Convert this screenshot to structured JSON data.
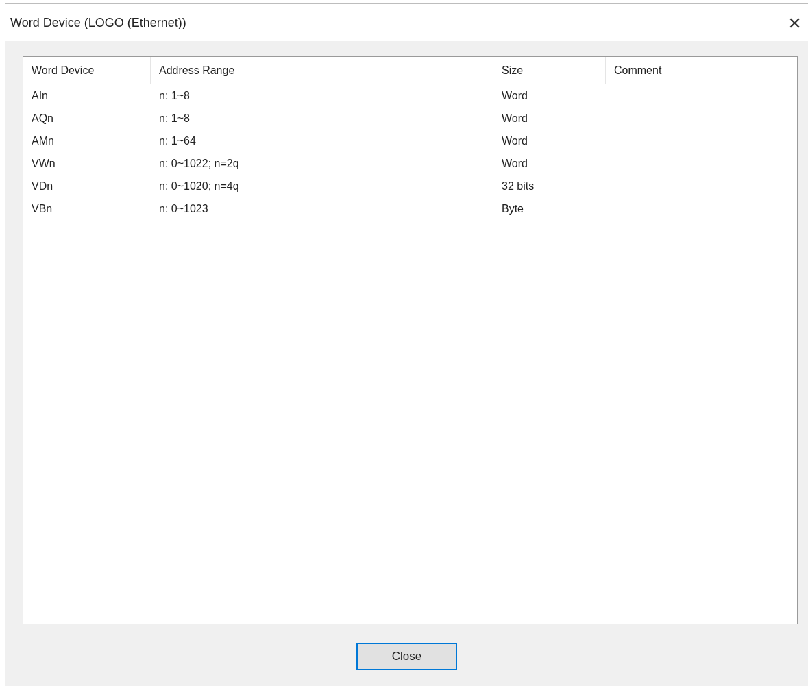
{
  "window": {
    "title": "Word Device (LOGO (Ethernet))",
    "close_glyph": "×"
  },
  "table": {
    "columns": [
      "Word Device",
      "Address Range",
      "Size",
      "Comment"
    ],
    "rows": [
      [
        "AIn",
        "n: 1~8",
        "Word"
      ],
      [
        "AQn",
        "n: 1~8",
        "Word"
      ],
      [
        "AMn",
        "n: 1~64",
        "Word"
      ],
      [
        "VWn",
        "n: 0~1022; n=2q",
        "Word"
      ],
      [
        "VDn",
        "n: 0~1020; n=4q",
        "32 bits"
      ],
      [
        "VBn",
        "n: 0~1023",
        "Byte"
      ]
    ]
  },
  "buttons": [
    {
      "label": "Close"
    }
  ]
}
